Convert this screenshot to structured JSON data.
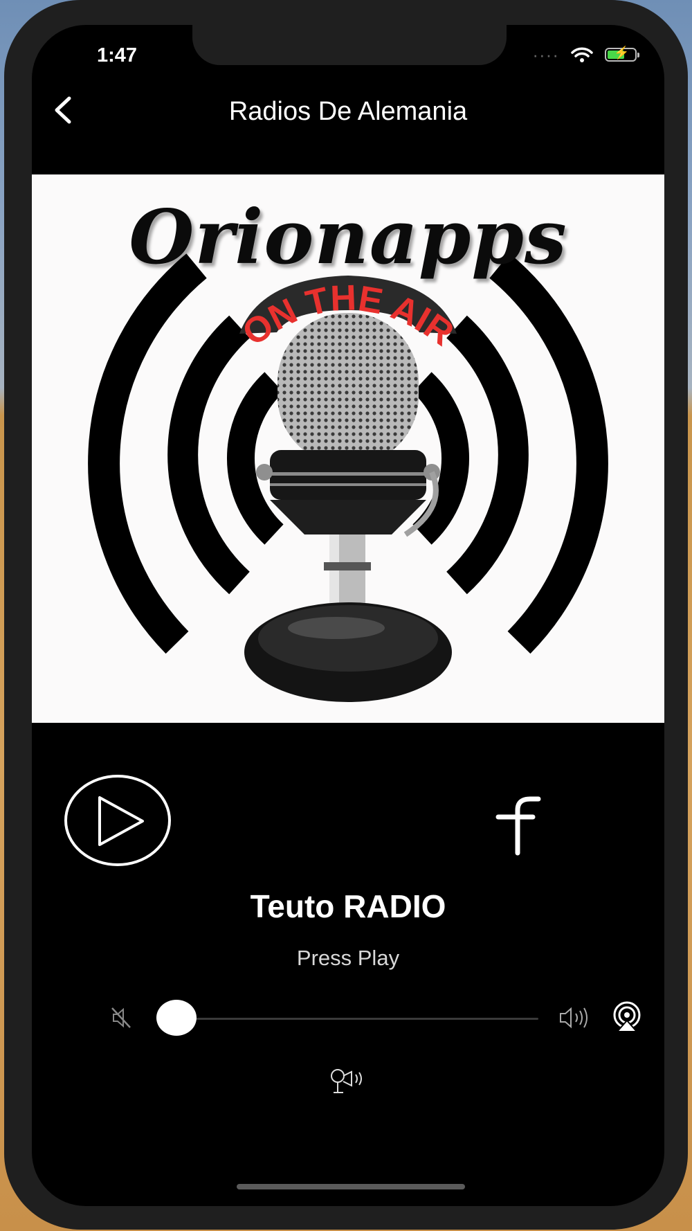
{
  "status_bar": {
    "time": "1:47"
  },
  "navbar": {
    "title": "Radios De Alemania"
  },
  "artwork": {
    "logo_text": "Orionapps",
    "tagline": "ON THE AIR"
  },
  "player": {
    "station_name": "Teuto RADIO",
    "status_text": "Press Play",
    "volume_level": 0.0
  },
  "colors": {
    "background": "#000000",
    "text": "#ffffff",
    "tagline": "#e8312e",
    "battery": "#49d849"
  },
  "icons": [
    "back-chevron-icon",
    "play-icon",
    "facebook-icon",
    "mute-icon",
    "volume-up-icon",
    "airplay-icon",
    "speaker-icon"
  ]
}
